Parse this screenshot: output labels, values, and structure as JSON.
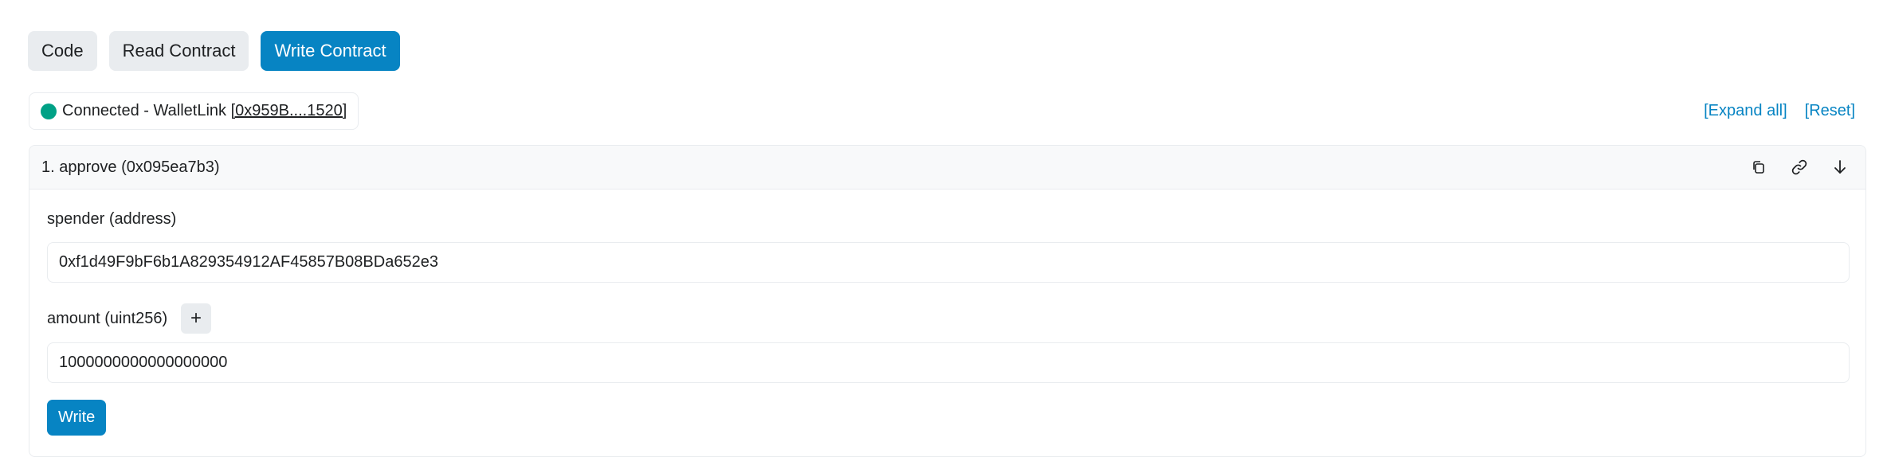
{
  "tabs": [
    {
      "label": "Code",
      "active": false
    },
    {
      "label": "Read Contract",
      "active": false
    },
    {
      "label": "Write Contract",
      "active": true
    }
  ],
  "connection": {
    "status_text": "Connected - WalletLink ",
    "address": "[0x959B....1520]",
    "status_color": "#00a186"
  },
  "actions": {
    "expand_all": "[Expand all]",
    "reset": "[Reset]"
  },
  "method": {
    "title": "1. approve (0x095ea7b3)",
    "icons": [
      "copy-icon",
      "link-icon",
      "arrow-down-icon"
    ],
    "params": [
      {
        "label": "spender (address)",
        "value": "0xf1d49F9bF6b1A829354912AF45857B08BDa652e3"
      },
      {
        "label": "amount (uint256)",
        "value": "1000000000000000000"
      }
    ],
    "plus_label": "+",
    "write_label": "Write"
  },
  "colors": {
    "accent": "#0784c3",
    "tab_bg": "#e9ecef"
  }
}
